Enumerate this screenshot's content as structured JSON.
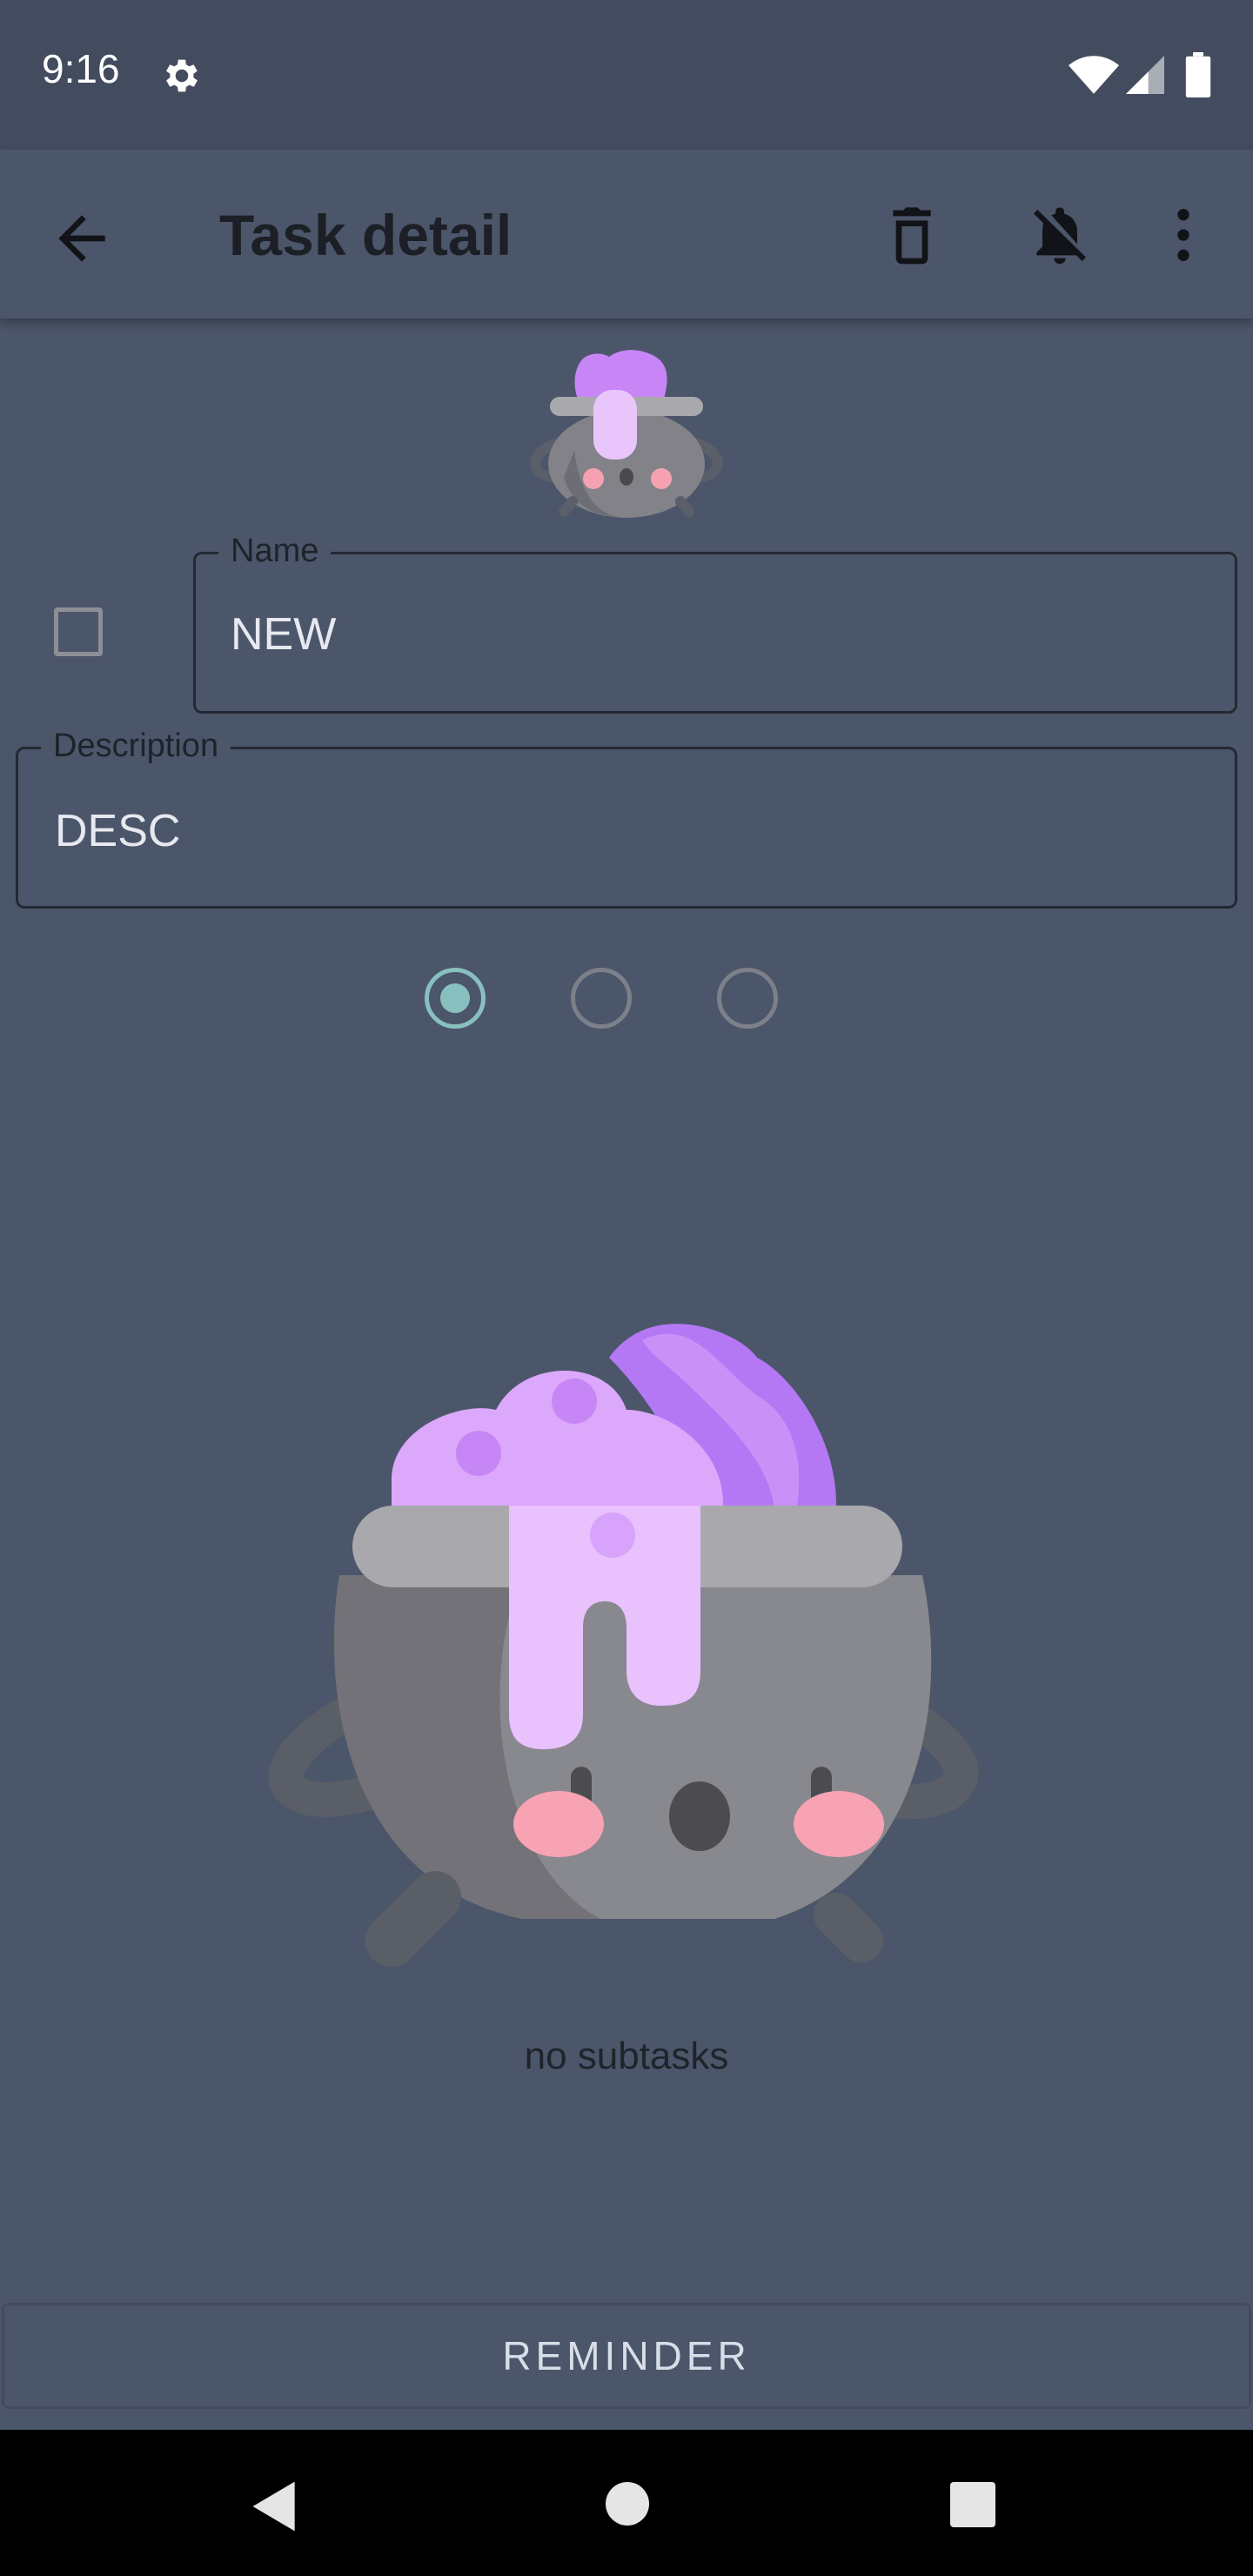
{
  "status_bar": {
    "time": "9:16",
    "icons": [
      "gear-icon",
      "wifi-icon",
      "signal-icon",
      "battery-icon"
    ]
  },
  "app_bar": {
    "title": "Task detail",
    "actions": [
      "back-arrow-icon",
      "delete-icon",
      "notifications-off-icon",
      "more-vert-icon"
    ]
  },
  "form": {
    "done_checked": false,
    "name_label": "Name",
    "name_value": "NEW",
    "description_label": "Description",
    "description_value": "DESC",
    "priority_options": 3,
    "priority_selected": 1
  },
  "subtasks": {
    "empty_text": "no subtasks",
    "illustration": "cauldron-illustration"
  },
  "reminder_button_label": "REMINDER",
  "colors": {
    "background": "#4c566a",
    "status_bar": "#434c5e",
    "accent": "#88c0c0",
    "potion": "#d8a1fb"
  }
}
